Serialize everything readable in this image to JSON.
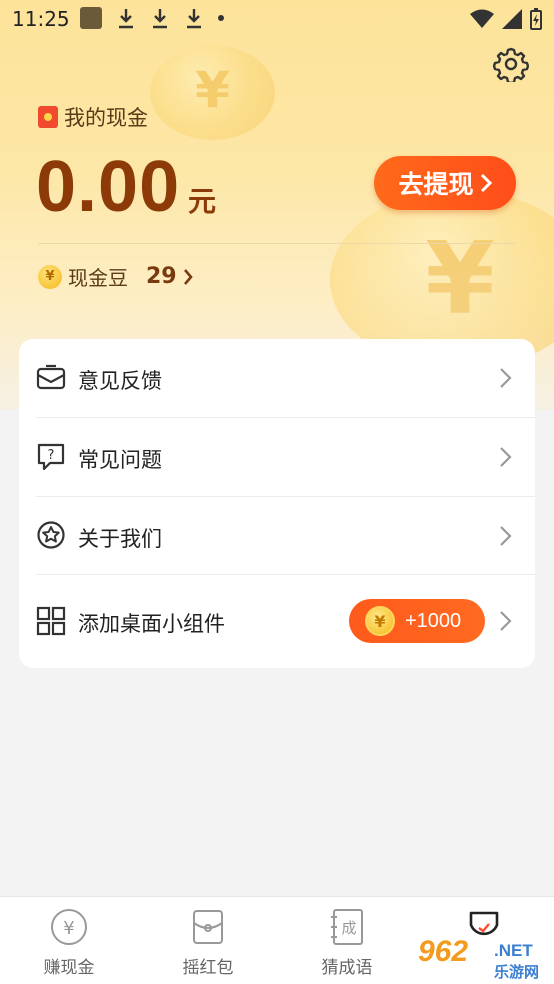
{
  "status_bar": {
    "time": "11:25"
  },
  "header": {
    "title": "我的现金",
    "amount": "0.00",
    "unit": "元",
    "withdraw_label": "去提现",
    "beans_label": "现金豆",
    "beans_count": "29",
    "coin_symbol": "¥"
  },
  "menu": {
    "items": [
      {
        "label": "意见反馈",
        "icon": "mail-icon"
      },
      {
        "label": "常见问题",
        "icon": "question-bubble-icon"
      },
      {
        "label": "关于我们",
        "icon": "star-circle-icon"
      },
      {
        "label": "添加桌面小组件",
        "icon": "grid-widget-icon",
        "reward": "+1000"
      }
    ]
  },
  "tabbar": {
    "tabs": [
      {
        "label": "赚现金",
        "icon": "yen-coin-icon"
      },
      {
        "label": "摇红包",
        "icon": "phone-shake-icon"
      },
      {
        "label": "猜成语",
        "icon": "book-idiom-icon"
      },
      {
        "label": "",
        "icon": "profile-icon"
      }
    ]
  },
  "watermark": {
    "number": "962",
    "suffix": ".NET",
    "site_cn": "乐游网"
  },
  "colors": {
    "accent": "#ff5a1c",
    "amount": "#8b3a08",
    "hero_top": "#fde39a"
  }
}
